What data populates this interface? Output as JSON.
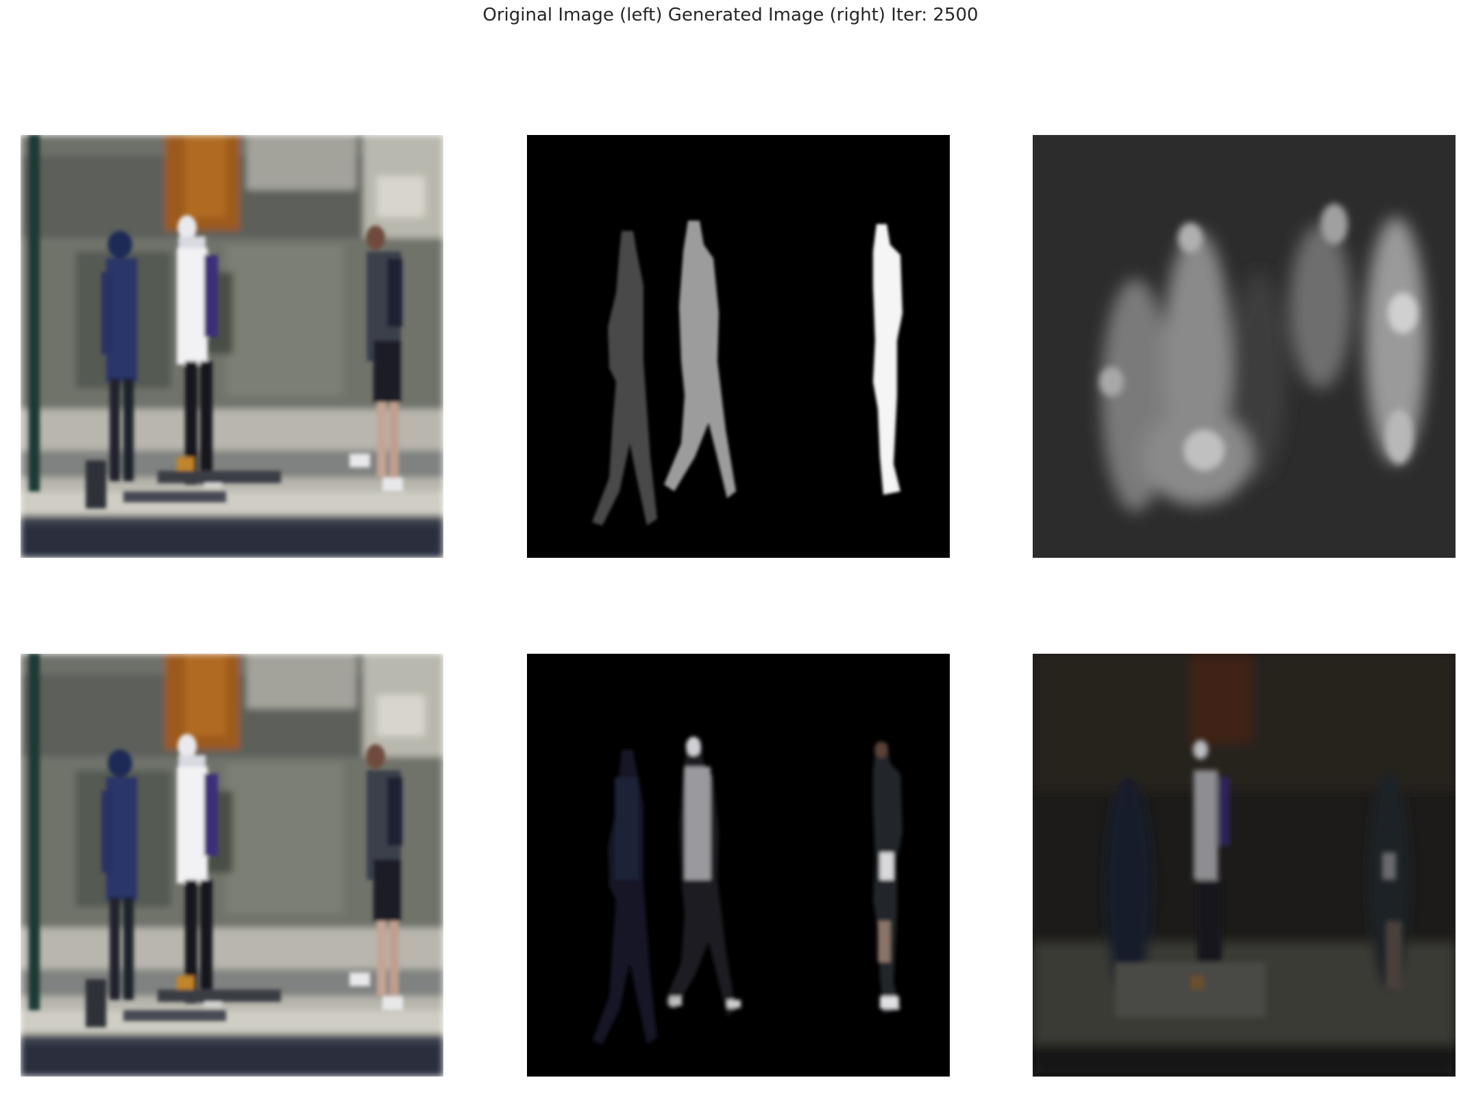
{
  "figure": {
    "title": "Original Image (left) Generated Image (right) Iter: 2500"
  },
  "rows": [
    {
      "panels": [
        {
          "content": "original-photo"
        },
        {
          "content": "segmentation-mask"
        },
        {
          "content": "generated-mask"
        }
      ]
    },
    {
      "panels": [
        {
          "content": "original-photo"
        },
        {
          "content": "masked-photo"
        },
        {
          "content": "generated-photo"
        }
      ]
    }
  ],
  "colors": {
    "background": "#ffffff",
    "title_text": "#262626"
  }
}
